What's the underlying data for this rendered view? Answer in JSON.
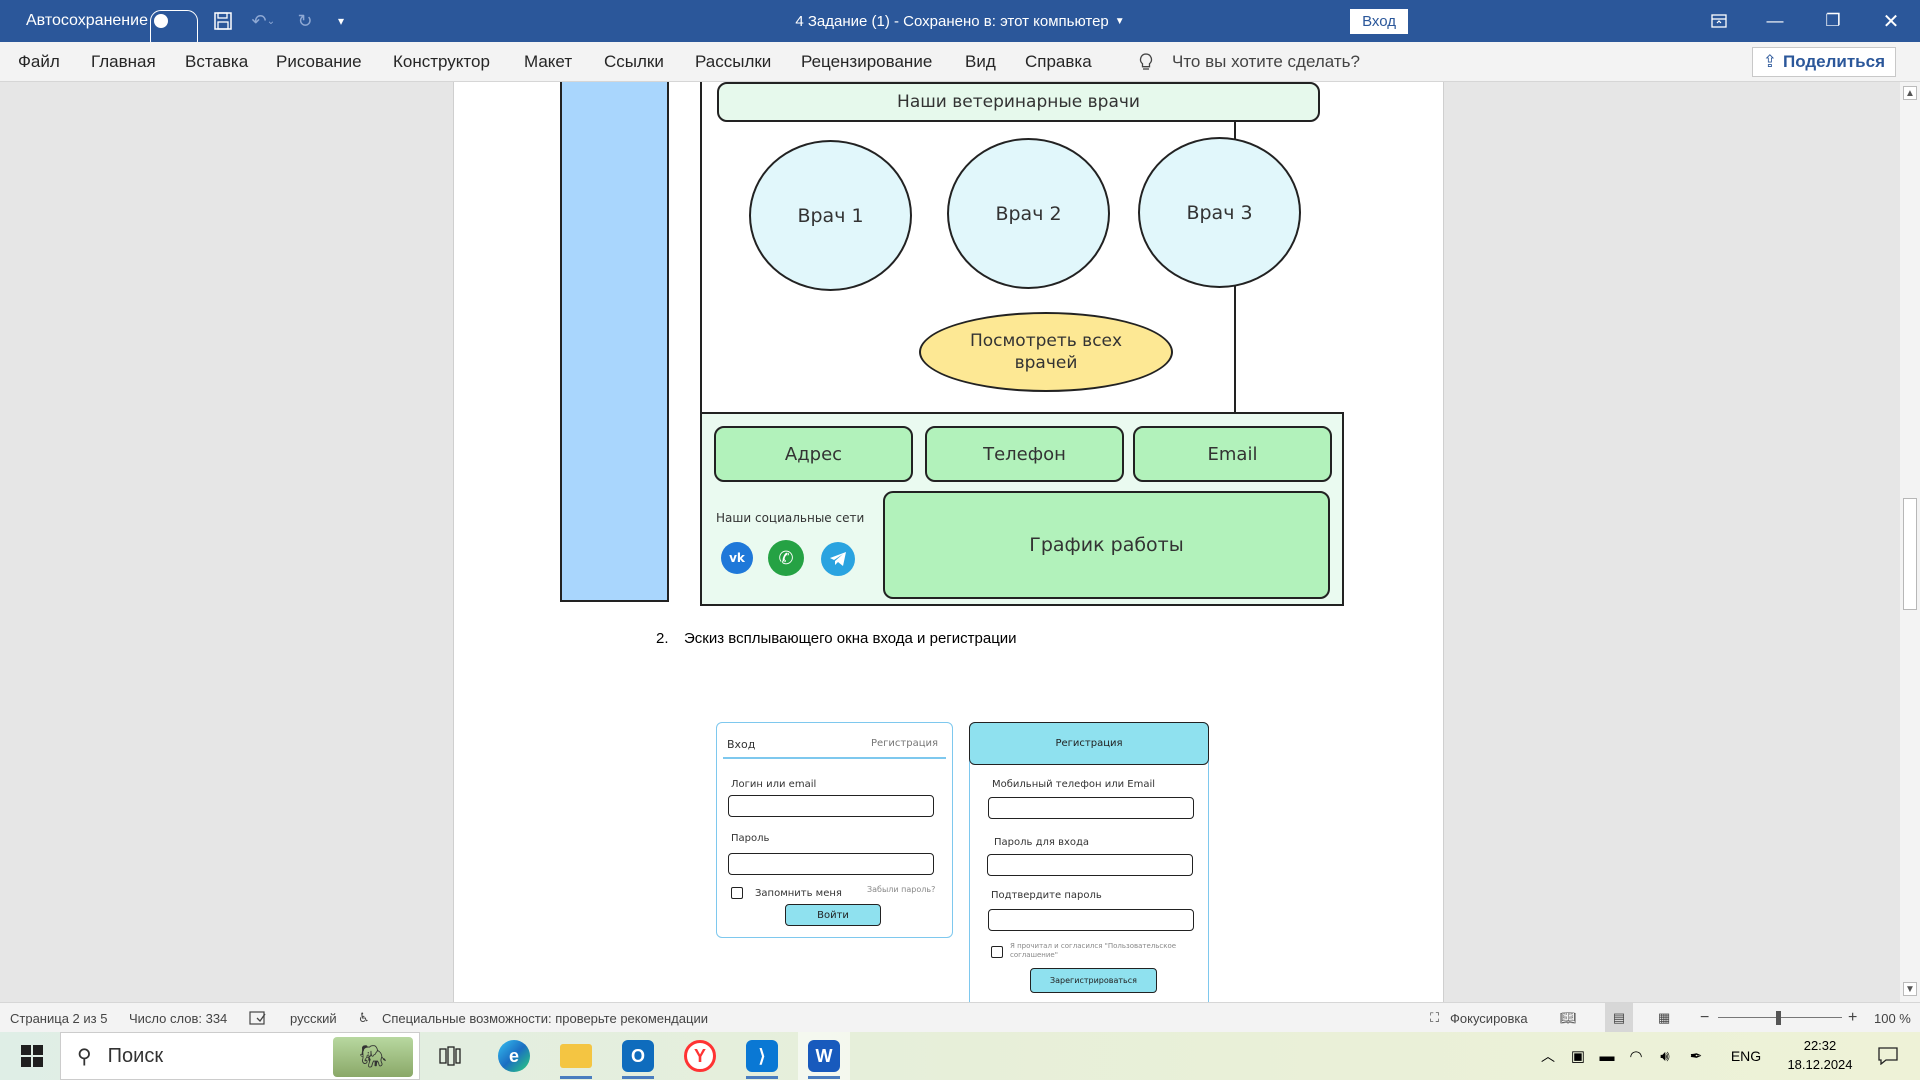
{
  "titlebar": {
    "autosave_label": "Автосохранение",
    "doc_title": "4 Задание (1)  -  Сохранено в: этот компьютер",
    "signin_label": "Вход"
  },
  "ribbon": {
    "tabs": [
      "Файл",
      "Главная",
      "Вставка",
      "Рисование",
      "Конструктор",
      "Макет",
      "Ссылки",
      "Рассылки",
      "Рецензирование",
      "Вид",
      "Справка"
    ],
    "search_placeholder": "Что вы хотите сделать?",
    "share_label": "Поделиться"
  },
  "sketch1": {
    "header": "Наши ветеринарные врачи",
    "doctors": [
      "Врач 1",
      "Врач 2",
      "Врач 3"
    ],
    "view_all": "Посмотреть всех врачей",
    "contacts": [
      "Адрес",
      "Телефон",
      "Email"
    ],
    "social_label": "Наши социальные сети",
    "schedule": "График работы",
    "colors": {
      "sidebar": "#a9d6fd",
      "circle": "#e1f7fb",
      "oval": "#fde894",
      "green": "#b2f2bb"
    }
  },
  "caption": {
    "num": "2.",
    "text": "Эскиз всплывающего окна входа и регистрации"
  },
  "login": {
    "tab_login": "Вход",
    "tab_register": "Регистрация",
    "login_label": "Логин или email",
    "password_label": "Пароль",
    "remember": "Запомнить меня",
    "forgot": "Забыли пароль?",
    "submit": "Войти"
  },
  "register": {
    "title": "Регистрация",
    "phone_label": "Мобильный телефон или Email",
    "password_label": "Пароль для входа",
    "confirm_label": "Подтвердите пароль",
    "agree": "Я прочитал и согласился \"Пользовательское соглашение\"",
    "submit": "Зарегистрироваться"
  },
  "statusbar": {
    "page": "Страница 2 из 5",
    "words": "Число слов: 334",
    "language": "русский",
    "accessibility": "Специальные возможности: проверьте рекомендации",
    "focus": "Фокусировка",
    "zoom": "100 %"
  },
  "taskbar": {
    "search_placeholder": "Поиск",
    "lang": "ENG",
    "time": "22:32",
    "date": "18.12.2024"
  }
}
